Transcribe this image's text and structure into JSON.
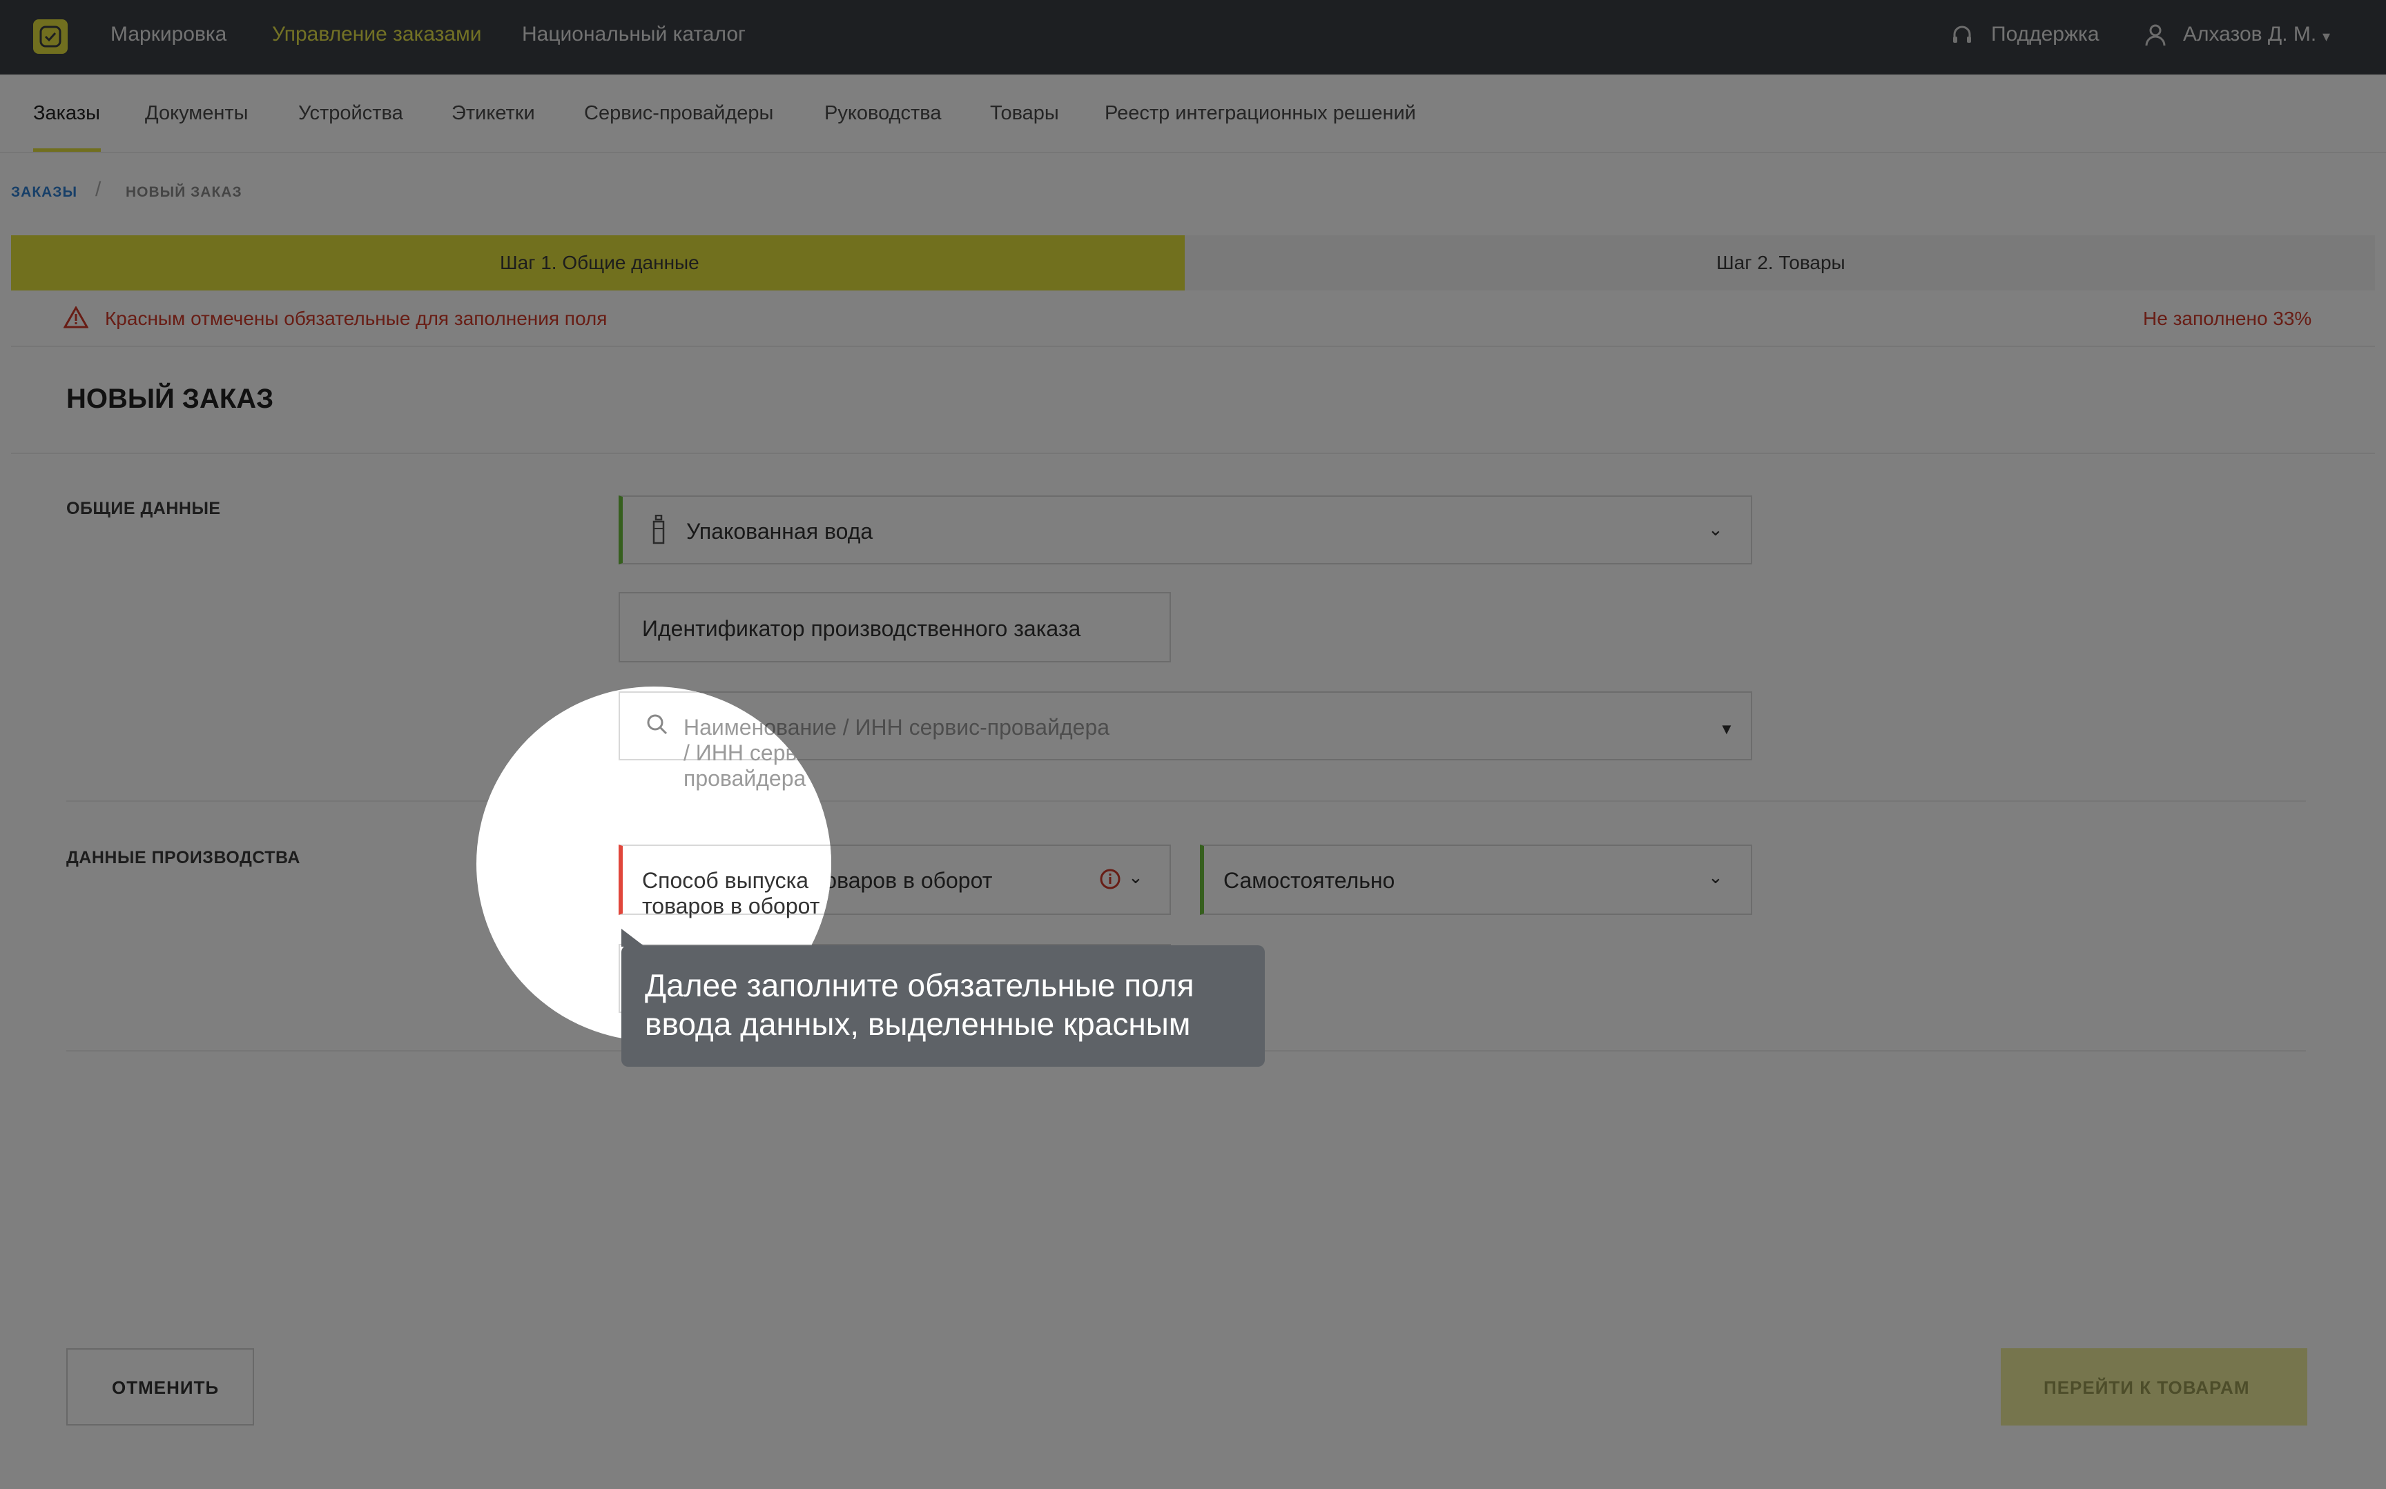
{
  "colors": {
    "topbar": "#3a3e44",
    "accent_yellow": "#e2de3f",
    "required_red": "#e0463b",
    "filled_green": "#6cbf3d",
    "tooltip_bg": "#5e6267"
  },
  "topbar": {
    "logo_icon": "check-badge-icon",
    "nav": [
      "Маркировка",
      "Управление заказами",
      "Национальный каталог"
    ],
    "support": "Поддержка",
    "user": "Алхазов Д. М."
  },
  "subnav": {
    "tabs": [
      "Заказы",
      "Документы",
      "Устройства",
      "Этикетки",
      "Сервис-провайдеры",
      "Руководства",
      "Товары",
      "Реестр интеграционных решений"
    ]
  },
  "breadcrumb": {
    "root": "ЗАКАЗЫ",
    "sep": "/",
    "current": "НОВЫЙ ЗАКАЗ"
  },
  "steps": {
    "step1": "Шаг 1. Общие данные",
    "step2": "Шаг 2. Товары"
  },
  "warning": {
    "text": "Красным отмечены обязательные для заполнения поля",
    "progress": "Не заполнено 33%"
  },
  "form": {
    "title": "НОВЫЙ ЗАКАЗ",
    "general_section": "ОБЩИЕ ДАННЫЕ",
    "product_group": "Упакованная вода",
    "production_order_id": "Идентификатор производственного заказа",
    "provider_placeholder": "Наименование / ИНН сервис-провайдера",
    "production_section": "ДАННЫЕ ПРОИЗВОДСТВА",
    "release_method": "Способ выпуска товаров в оборот",
    "production_mode": "Самостоятельно"
  },
  "buttons": {
    "cancel": "ОТМЕНИТЬ",
    "next": "ПЕРЕЙТИ К ТОВАРАМ"
  },
  "tooltip": {
    "line1": "Далее заполните обязательные поля",
    "line2": "ввода данных, выделенные красным"
  }
}
